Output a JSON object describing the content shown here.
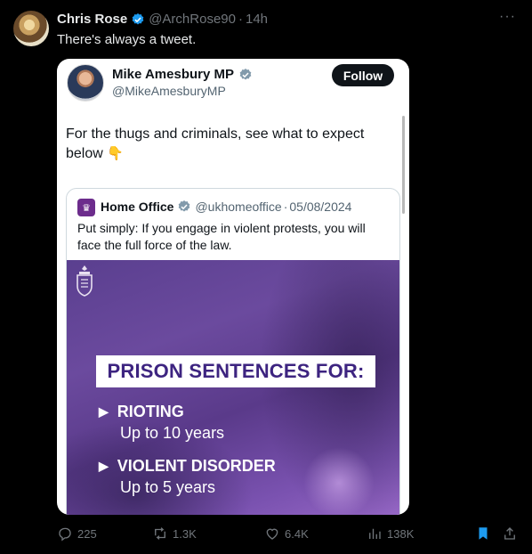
{
  "tweet": {
    "author_name": "Chris Rose",
    "author_handle": "@ArchRose90",
    "separator": "·",
    "time": "14h",
    "text": "There's always a tweet.",
    "more_icon": "more-horizontal-icon"
  },
  "embedded": {
    "author_name": "Mike Amesbury MP",
    "author_handle": "@MikeAmesburyMP",
    "follow_label": "Follow",
    "text": "For the thugs and criminals, see what to expect below",
    "emoji": "👇",
    "quote": {
      "author_name": "Home Office",
      "author_handle": "@ukhomeoffice",
      "separator": "·",
      "date": "05/08/2024",
      "text": "Put simply: If you engage in violent protests, you will face the full force of the law.",
      "image": {
        "banner": "PRISON SENTENCES FOR:",
        "items": [
          {
            "title": "RIOTING",
            "sentence": "Up to 10 years"
          },
          {
            "title": "VIOLENT DISORDER",
            "sentence": "Up to 5 years"
          }
        ],
        "accent": "#3d2480"
      }
    }
  },
  "actions": {
    "replies": "225",
    "reposts": "1.3K",
    "likes": "6.4K",
    "views": "138K"
  },
  "colors": {
    "background": "#000000",
    "muted": "#71767b",
    "verified": "#1d9bf0",
    "bookmark": "#1d9bf0"
  }
}
